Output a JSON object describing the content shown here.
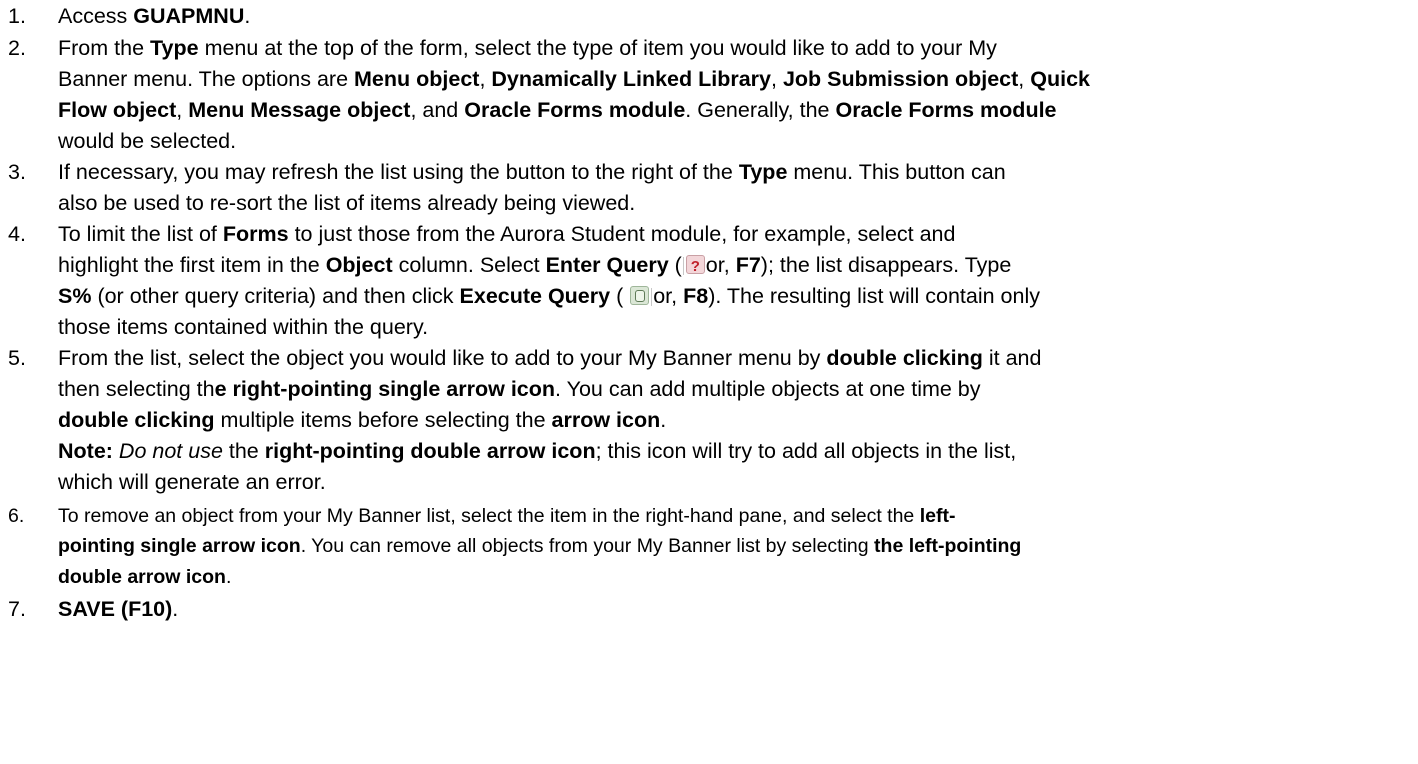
{
  "items": [
    {
      "num": "1.",
      "lines": [
        {
          "segs": [
            [
              "Access ",
              0
            ],
            [
              "GUAPMNU",
              1
            ],
            [
              ".",
              0
            ]
          ]
        }
      ]
    },
    {
      "num": "2.",
      "lines": [
        {
          "segs": [
            [
              "From the ",
              0
            ],
            [
              "Type",
              1
            ],
            [
              "  menu at the top of the form, select the type of item you would like to add to your My",
              0
            ]
          ]
        },
        {
          "segs": [
            [
              "Banner menu. The options are ",
              0
            ],
            [
              "Menu object",
              1
            ],
            [
              ", ",
              0
            ],
            [
              "Dynamically Linked Library",
              1
            ],
            [
              ", ",
              0
            ],
            [
              "Job Submission object",
              1
            ],
            [
              ", ",
              0
            ],
            [
              "Quick",
              1
            ]
          ]
        },
        {
          "segs": [
            [
              "Flow object",
              1
            ],
            [
              ", ",
              0
            ],
            [
              "Menu Message object",
              1
            ],
            [
              ", and ",
              0
            ],
            [
              "Oracle Forms module",
              1
            ],
            [
              ".  Generally, the ",
              0
            ],
            [
              "Oracle Forms module",
              1
            ]
          ]
        },
        {
          "segs": [
            [
              "would be selected.",
              0
            ]
          ]
        }
      ]
    },
    {
      "num": "3.",
      "lines": [
        {
          "segs": [
            [
              "If necessary, you may refresh the list using the button to the right of the ",
              0
            ],
            [
              "Type",
              1
            ],
            [
              " menu.  This button can",
              0
            ]
          ]
        },
        {
          "segs": [
            [
              "also be used to re-sort the list of items already being viewed.",
              0
            ]
          ]
        }
      ]
    },
    {
      "num": "4.",
      "lines": [
        {
          "segs": [
            [
              "To limit the list of ",
              0
            ],
            [
              "Forms",
              1
            ],
            [
              " to just those from the Aurora Student module, for example, select and",
              0
            ]
          ]
        },
        {
          "segs": [
            [
              "highlight the first item in the ",
              0
            ],
            [
              "Object",
              1
            ],
            [
              " column.  Select ",
              0
            ],
            [
              "Enter Query",
              1
            ],
            [
              " (",
              0
            ],
            [
              "enter-query-icon",
              4
            ],
            [
              "or, ",
              0
            ],
            [
              "F7",
              1
            ],
            [
              "); the list disappears.  Type",
              0
            ]
          ]
        },
        {
          "segs": [
            [
              "S%",
              1
            ],
            [
              " (or other query criteria) and then click ",
              0
            ],
            [
              "Execute Query",
              1
            ],
            [
              " ( ",
              0
            ],
            [
              "execute-query-icon",
              5
            ],
            [
              "or, ",
              0
            ],
            [
              "F8",
              1
            ],
            [
              ").  The resulting list will contain only",
              0
            ]
          ]
        },
        {
          "segs": [
            [
              "those items contained within the query.",
              0
            ]
          ]
        }
      ]
    },
    {
      "num": "5.",
      "lines": [
        {
          "segs": [
            [
              "From the list, select the object you would like to add to your My Banner menu by ",
              0
            ],
            [
              "double clicking",
              1
            ],
            [
              " it and",
              0
            ]
          ]
        },
        {
          "segs": [
            [
              "then selecting th",
              0
            ],
            [
              "e right-pointing single arrow icon",
              1
            ],
            [
              ".  You can add multiple objects at one time by",
              0
            ]
          ]
        },
        {
          "segs": [
            [
              "double clicking",
              1
            ],
            [
              " multiple items before selecting the ",
              0
            ],
            [
              "arrow icon",
              1
            ],
            [
              ".",
              0
            ]
          ]
        },
        {
          "segs": [
            [
              "Note:",
              1
            ],
            [
              " ",
              0
            ],
            [
              "Do not use",
              2
            ],
            [
              " the ",
              0
            ],
            [
              "right-pointing double arrow icon",
              1
            ],
            [
              "; this icon will try to add all objects in the list,",
              0
            ]
          ]
        },
        {
          "segs": [
            [
              "which will generate an error.",
              0
            ]
          ]
        }
      ]
    },
    {
      "num": "6.",
      "small": true,
      "lines": [
        {
          "segs": [
            [
              "To remove an object from your My Banner list, select the item in the right-hand pane, and select the ",
              0
            ],
            [
              "left-",
              1
            ]
          ]
        },
        {
          "segs": [
            [
              "pointing single arrow icon",
              1
            ],
            [
              ". You can remove all objects from your My Banner list by selecting ",
              0
            ],
            [
              "the left-pointing",
              1
            ]
          ]
        },
        {
          "segs": [
            [
              "double arrow icon",
              1
            ],
            [
              ".",
              0
            ]
          ]
        }
      ]
    },
    {
      "num": "7.",
      "lines": [
        {
          "segs": [
            [
              "SAVE (F10)",
              1
            ],
            [
              ".",
              0
            ]
          ]
        }
      ]
    }
  ]
}
